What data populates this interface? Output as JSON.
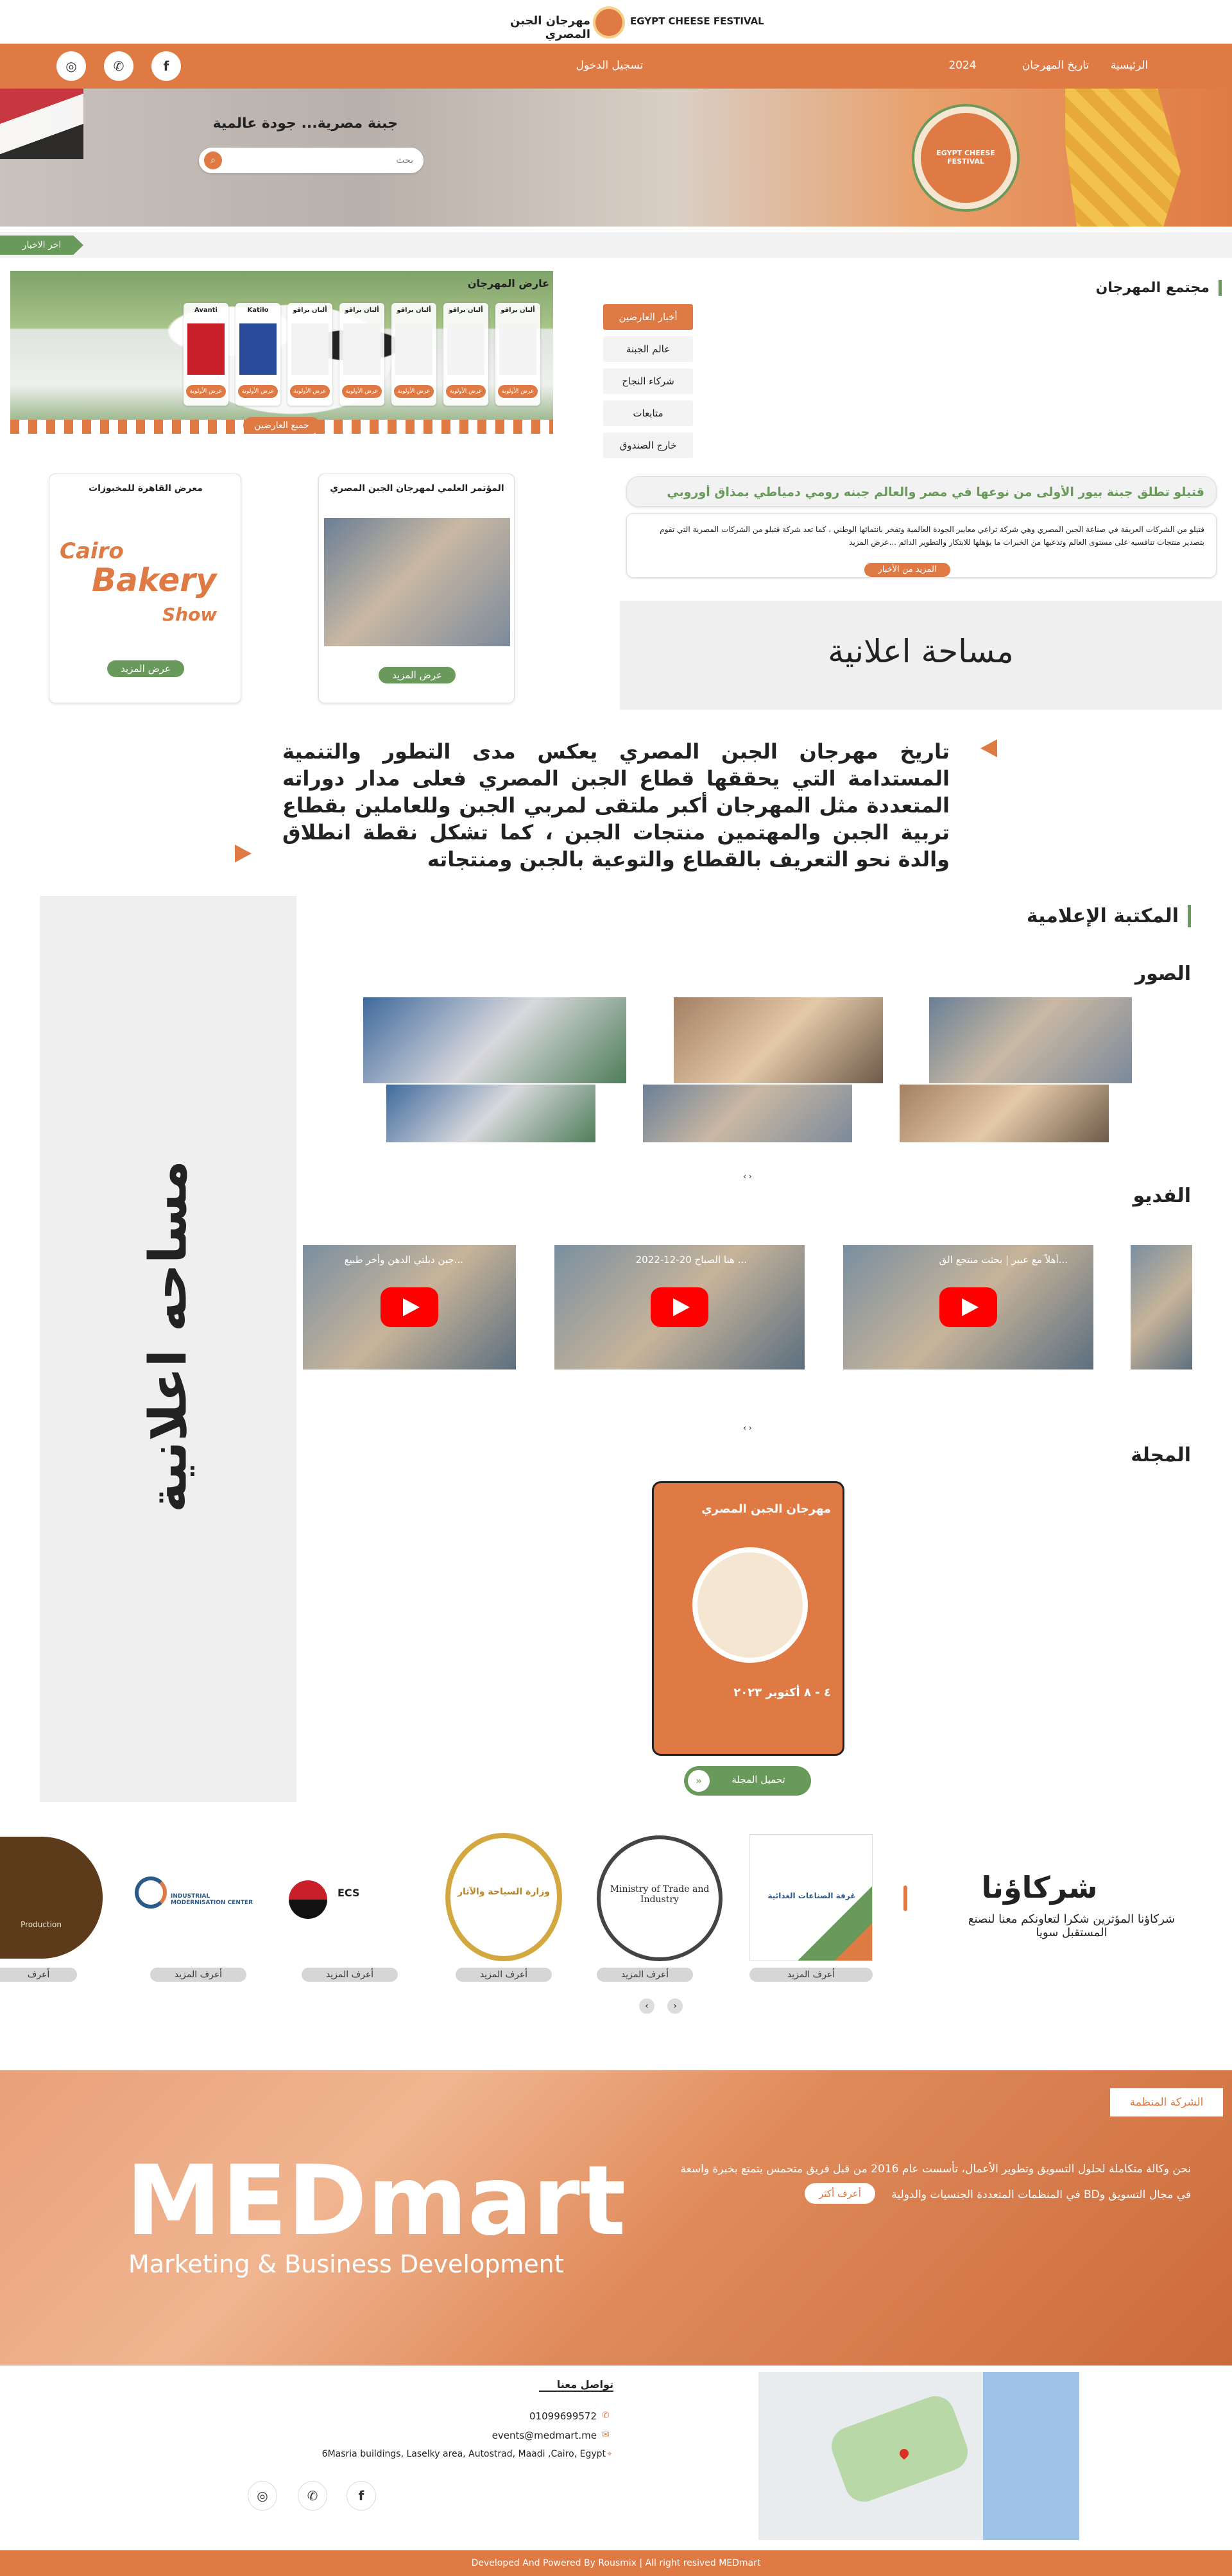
{
  "header": {
    "site_name_ar": "مهرجان الجبن المصري",
    "site_name_en": "EGYPT CHEESE FESTIVAL"
  },
  "nav": {
    "items": [
      "الرئيسية",
      "تاريخ المهرجان",
      "2024"
    ],
    "login": "تسجيل الدخول",
    "social": [
      "facebook-icon",
      "whatsapp-icon",
      "instagram-icon"
    ]
  },
  "hero": {
    "tagline": "جبنة مصرية... جودة عالمية",
    "search_placeholder": "بحث",
    "logo_text": "EGYPT CHEESE FESTIVAL"
  },
  "news_ticker": {
    "label": "اخر الاخبار"
  },
  "community": {
    "title": "مجتمع المهرجان",
    "tabs": [
      "أخبار العارضين",
      "عالم الجبنة",
      "شركاء النجاح",
      "متابعات",
      "خارج الصندوق"
    ],
    "news_headline": "قتيلو تطلق جبنة بيور الأولى من نوعها في مصر والعالم جبنه رومي دمياطي بمذاق أوروبي",
    "news_body": "قتيلو من الشركات العريقة في صناعة الجبن المصري وهي شركة تراعي معايير الجودة العالمية وتفخر بانتمائها الوطني ، كما تعد شركة قتيلو من الشركات المصرية التي تقوم بتصدير منتجات تنافسيه على مستوى العالم وتدعيها من الخبرات ما يؤهلها للابتكار والتطوير الدائم ...عرض المزيد",
    "more_news": "المزيد من الأخبار",
    "ad_space": "مساحة اعلانية"
  },
  "exhibitors": {
    "title": "عارض المهرجان",
    "cards": [
      {
        "label": "ألبان براقو",
        "btn": "عرض الأولوية"
      },
      {
        "label": "ألبان براقو",
        "btn": "عرض الأولوية"
      },
      {
        "label": "ألبان براقو",
        "btn": "عرض الأولوية"
      },
      {
        "label": "ألبان براقو",
        "btn": "عرض الأولوية"
      },
      {
        "label": "ألبان براقو",
        "btn": "عرض الأولوية"
      },
      {
        "label": "Katilo",
        "btn": "عرض الأولوية"
      },
      {
        "label": "Avanti",
        "btn": "عرض الأولوية"
      }
    ],
    "all_btn": "جميع العارضين"
  },
  "events": [
    {
      "title": "المؤتمر العلمي لمهرجان الجبن المصري",
      "btn": "عرض المزيد"
    },
    {
      "title": "معرض القاهرة للمخبوزات",
      "btn": "عرض المزيد",
      "logo_line1": "Cairo",
      "logo_line2": "Bakery",
      "logo_line3": "Show"
    }
  ],
  "history": {
    "text": "تاريخ مهرجان الجبن المصري يعكس مدى التطور والتنمية المستدامة التي يحققها قطاع الجبن المصري فعلى مدار دوراته المتعددة مثل المهرجان أكبر ملتقى لمربي الجبن وللعاملين بقطاع تربية الجبن والمهتمين منتجات الجبن ، كما تشكل نقطة انطلاق والدة نحو التعريف بالقطاع والتوعية بالجبن ومنتجاته"
  },
  "media": {
    "title": "المكتبة الإعلامية",
    "photos_title": "الصور",
    "videos_title": "الفديو",
    "videos": [
      {
        "title": "أهلاً مع عبير | بحثت منتجع الق..."
      },
      {
        "title": "هنا الصباح 20-12-2022 ..."
      },
      {
        "title": "جبن دبلتي الدهن وأخر طبيع..."
      }
    ],
    "magazine_title": "المجلة",
    "magazine_cover_title": "مهرجان الجبن المصري",
    "magazine_cover_date": "٤ - ٨ أكتوبر ٢٠٢٣",
    "magazine_btn": "تحميل المجلة",
    "side_text": "مساحه اعلانية"
  },
  "partners": {
    "title": "شركاؤنا",
    "subtitle": "شركاؤنا المؤثرين شكرا لتعاونكم معنا لنصنع المستقبل سويا",
    "items": [
      {
        "name": "غرفة الصناعات الغذائية",
        "btn": "أعرف المزيد"
      },
      {
        "name": "Ministry of Trade and Industry",
        "btn": "أعرف المزيد"
      },
      {
        "name": "وزارة السياحة والآثار",
        "btn": "أعرف المزيد"
      },
      {
        "name": "ECS",
        "btn": "أعرف المزيد"
      },
      {
        "name": "INDUSTRIAL MODERNISATION CENTER",
        "btn": "أعرف المزيد"
      },
      {
        "name": "Production",
        "btn": "أعرف"
      }
    ]
  },
  "company": {
    "label": "الشركة المنظمة",
    "body": "نحن وكالة متكاملة لحلول التسويق وتطوير الأعمال، تأسست عام 2016 من قبل فريق متحمس يتمتع بخبرة واسعة في مجال التسويق وBD في المنظمات المتعددة الجنسيات والدولية",
    "more": "أعرف أكثر",
    "brand": "MEDmart",
    "brand_sub": "Marketing & Business Development"
  },
  "footer": {
    "contact_title": "تواصل معنا",
    "phone": "01099699572",
    "email": "events@medmart.me",
    "address": "6Masria buildings, Laselky area, Autostrad, Maadi ,Cairo, Egypt",
    "copyright": "Developed And Powered By Rousmix | All right resived MEDmart"
  },
  "colors": {
    "accent": "#e07a45",
    "green": "#6a9a5b"
  }
}
